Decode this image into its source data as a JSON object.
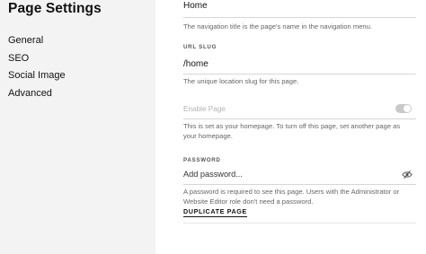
{
  "sidebar": {
    "title": "Page Settings",
    "items": [
      {
        "label": "General"
      },
      {
        "label": "SEO"
      },
      {
        "label": "Social Image"
      },
      {
        "label": "Advanced"
      }
    ]
  },
  "main": {
    "navigation_title": {
      "value": "Home",
      "help": "The navigation title is the page's name in the navigation menu."
    },
    "url_slug": {
      "label": "URL SLUG",
      "value": "/home",
      "help": "The unique location slug for this page."
    },
    "enable_page": {
      "label": "Enable Page",
      "enabled": true,
      "disabled": true,
      "help": "This is set as your homepage. To turn off this page, set another page as your homepage."
    },
    "password": {
      "label": "PASSWORD",
      "placeholder": "Add password...",
      "icon": "eye-slash-icon",
      "help": "A password is required to see this page. Users with the Administrator or Website Editor role don't need a password."
    },
    "duplicate_button": "DUPLICATE PAGE"
  }
}
